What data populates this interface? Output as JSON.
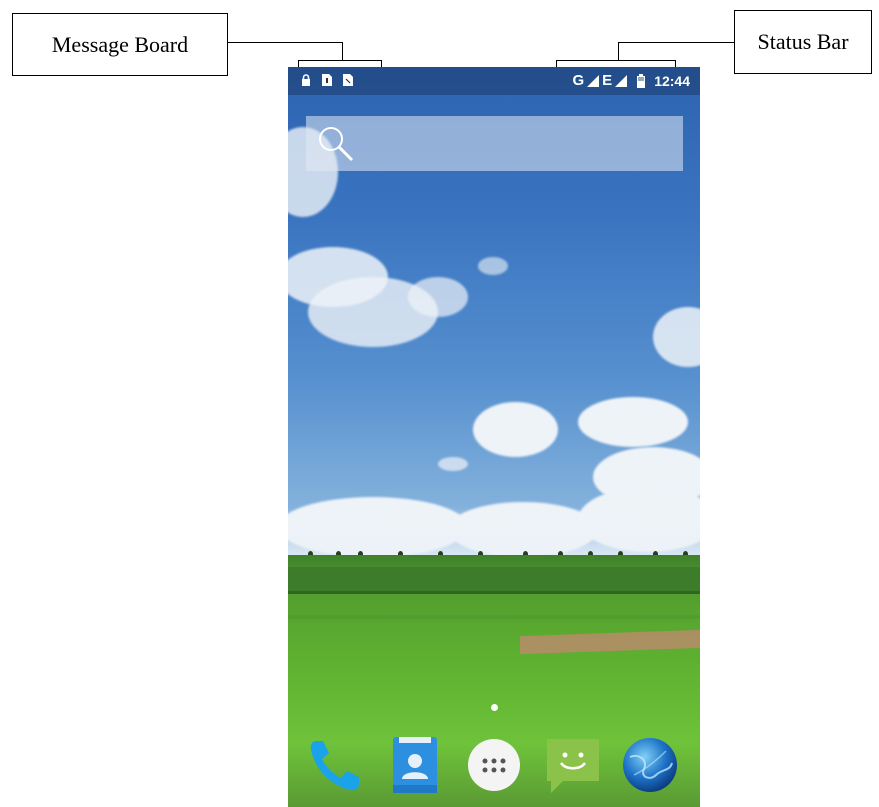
{
  "callouts": {
    "message_board": "Message Board",
    "status_bar": "Status Bar"
  },
  "status_bar": {
    "left_icons": [
      "lock-icon",
      "sim-card-icon",
      "sd-card-icon"
    ],
    "network_1": "G",
    "network_2": "E",
    "time": "12:44"
  },
  "search": {
    "icon": "search-icon"
  },
  "home": {
    "page_indicator_count": 1,
    "active_page": 1
  },
  "dock": {
    "apps": [
      "phone-icon",
      "contacts-icon",
      "app-drawer-icon",
      "messaging-icon",
      "browser-icon"
    ]
  },
  "colors": {
    "sky": "#3a74c0",
    "grass": "#64b733",
    "phone_app": "#1aa3e8",
    "contacts_app": "#2c8fe0",
    "messaging_app": "#8bc34a"
  }
}
